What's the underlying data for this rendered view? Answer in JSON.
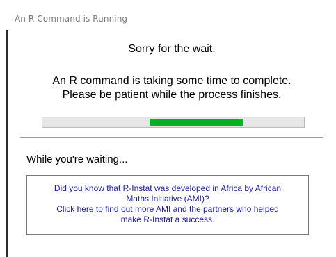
{
  "window": {
    "title": "An R Command is Running"
  },
  "dialog": {
    "heading": "Sorry for the wait.",
    "message_line1": "An R command is taking some time to complete.",
    "message_line2": "Please be patient while the process finishes.",
    "progress": {
      "segment_start": 0.41,
      "segment_end": 0.77,
      "fill_color": "#06b025"
    },
    "waiting_label": "While you're waiting...",
    "info": {
      "line1": "Did you know that R-Instat was developed in Africa by African",
      "line2": "Maths Initiative (AMI)?",
      "line3": "Click here to find out more AMI and the partners who helped",
      "line4": "make R-Instat a success.",
      "link_color": "#1a1aa6"
    }
  }
}
